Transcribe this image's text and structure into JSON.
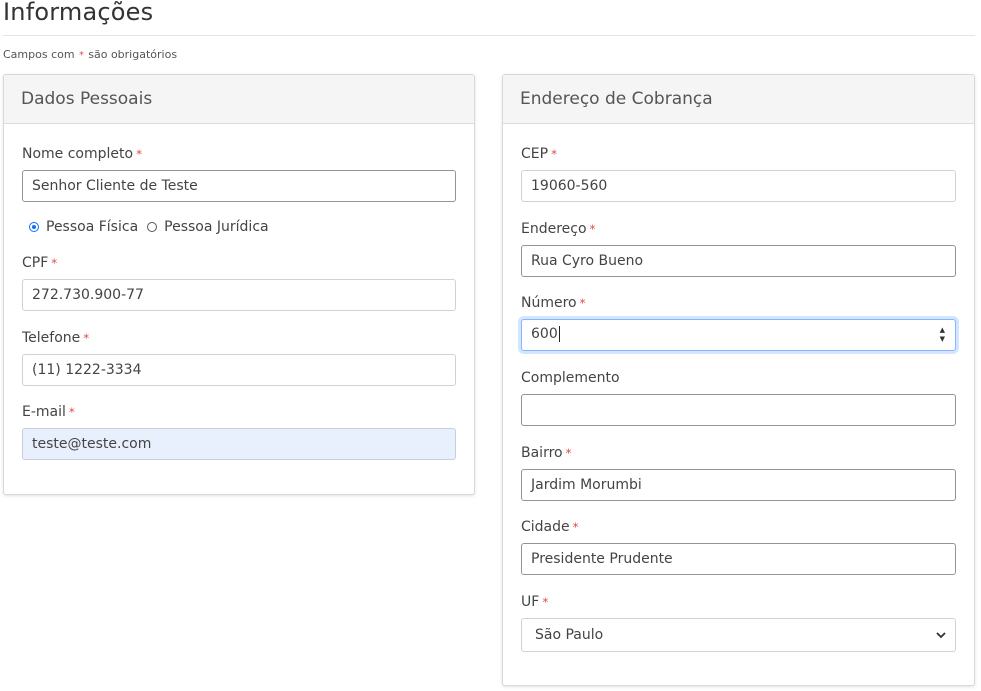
{
  "page": {
    "title": "Informações",
    "required_note_prefix": "Campos com",
    "required_note_suffix": "são obrigatórios",
    "required_mark": "*"
  },
  "personal": {
    "header": "Dados Pessoais",
    "full_name_label": "Nome completo",
    "full_name_value": "Senhor Cliente de Teste",
    "person_type_options": [
      "Pessoa Física",
      "Pessoa Jurídica"
    ],
    "person_type_selected": "Pessoa Física",
    "cpf_label": "CPF",
    "cpf_value": "272.730.900-77",
    "phone_label": "Telefone",
    "phone_value": "(11) 1222-3334",
    "email_label": "E-mail",
    "email_value": "teste@teste.com"
  },
  "billing": {
    "header": "Endereço de Cobrança",
    "cep_label": "CEP",
    "cep_value": "19060-560",
    "address_label": "Endereço",
    "address_value": "Rua Cyro Bueno",
    "number_label": "Número",
    "number_value": "600",
    "complement_label": "Complemento",
    "complement_value": "",
    "district_label": "Bairro",
    "district_value": "Jardim Morumbi",
    "city_label": "Cidade",
    "city_value": "Presidente Prudente",
    "state_label": "UF",
    "state_value": "São Paulo"
  },
  "colors": {
    "required": "#e04848",
    "focus_border": "#86b7fe",
    "autofill_background": "#e8f0fe",
    "radio_selected": "#0d6efd"
  }
}
